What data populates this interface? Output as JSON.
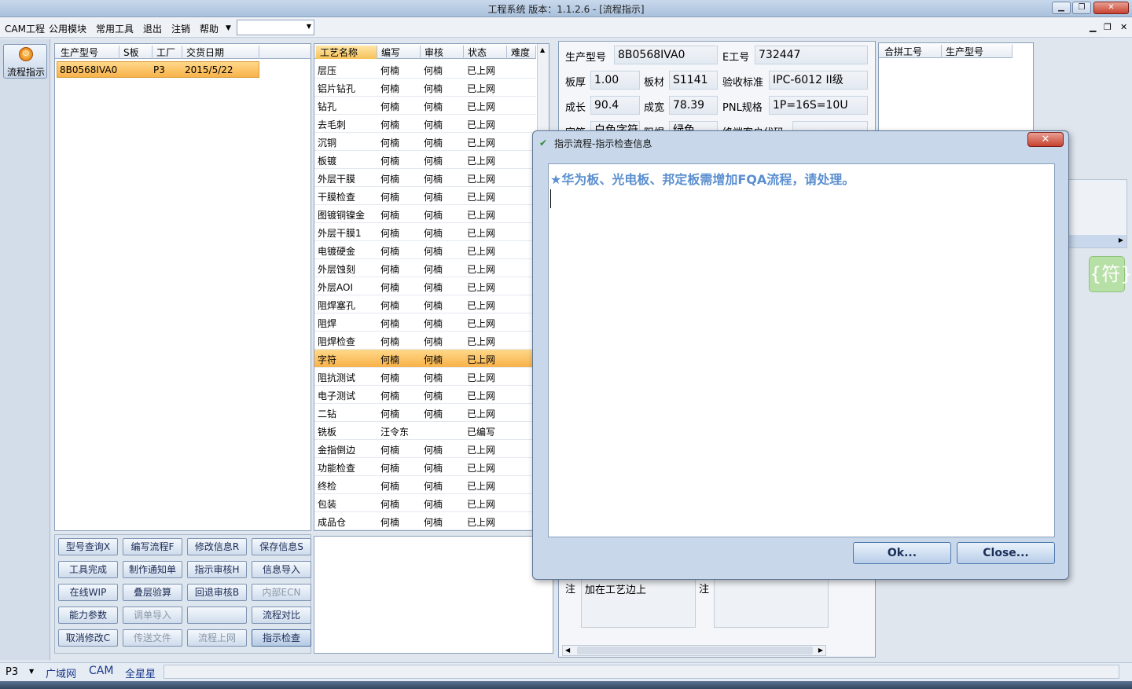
{
  "window": {
    "title": "工程系统  版本：1.1.2.6 - [流程指示]"
  },
  "menu": {
    "items": [
      "CAM工程",
      "公用模块",
      "常用工具",
      "退出",
      "注销",
      "帮助"
    ],
    "combo_value": ""
  },
  "sidebar": {
    "button_label": "流程指示"
  },
  "orders": {
    "columns": [
      "生产型号",
      "S板",
      "工厂",
      "交货日期"
    ],
    "rows": [
      {
        "model": "8B0568IVA0",
        "s": "",
        "factory": "P3",
        "date": "2015/5/22"
      }
    ]
  },
  "process": {
    "columns": [
      "工艺名称",
      "编写",
      "审核",
      "状态",
      "难度"
    ],
    "rows": [
      {
        "name": "层压",
        "writer": "何楠",
        "reviewer": "何楠",
        "status": "已上网"
      },
      {
        "name": "铝片钻孔",
        "writer": "何楠",
        "reviewer": "何楠",
        "status": "已上网"
      },
      {
        "name": "钻孔",
        "writer": "何楠",
        "reviewer": "何楠",
        "status": "已上网"
      },
      {
        "name": "去毛刺",
        "writer": "何楠",
        "reviewer": "何楠",
        "status": "已上网"
      },
      {
        "name": "沉铜",
        "writer": "何楠",
        "reviewer": "何楠",
        "status": "已上网"
      },
      {
        "name": "板镀",
        "writer": "何楠",
        "reviewer": "何楠",
        "status": "已上网"
      },
      {
        "name": "外层干膜",
        "writer": "何楠",
        "reviewer": "何楠",
        "status": "已上网"
      },
      {
        "name": "干膜检查",
        "writer": "何楠",
        "reviewer": "何楠",
        "status": "已上网"
      },
      {
        "name": "图镀铜镍金",
        "writer": "何楠",
        "reviewer": "何楠",
        "status": "已上网"
      },
      {
        "name": "外层干膜1",
        "writer": "何楠",
        "reviewer": "何楠",
        "status": "已上网"
      },
      {
        "name": "电镀硬金",
        "writer": "何楠",
        "reviewer": "何楠",
        "status": "已上网"
      },
      {
        "name": "外层蚀刻",
        "writer": "何楠",
        "reviewer": "何楠",
        "status": "已上网"
      },
      {
        "name": "外层AOI",
        "writer": "何楠",
        "reviewer": "何楠",
        "status": "已上网"
      },
      {
        "name": "阻焊塞孔",
        "writer": "何楠",
        "reviewer": "何楠",
        "status": "已上网"
      },
      {
        "name": "阻焊",
        "writer": "何楠",
        "reviewer": "何楠",
        "status": "已上网"
      },
      {
        "name": "阻焊检查",
        "writer": "何楠",
        "reviewer": "何楠",
        "status": "已上网"
      },
      {
        "name": "字符",
        "writer": "何楠",
        "reviewer": "何楠",
        "status": "已上网"
      },
      {
        "name": "阻抗测试",
        "writer": "何楠",
        "reviewer": "何楠",
        "status": "已上网"
      },
      {
        "name": "电子测试",
        "writer": "何楠",
        "reviewer": "何楠",
        "status": "已上网"
      },
      {
        "name": "二钻",
        "writer": "何楠",
        "reviewer": "何楠",
        "status": "已上网"
      },
      {
        "name": "铣板",
        "writer": "汪令东",
        "reviewer": "",
        "status": "已编写"
      },
      {
        "name": "金指倒边",
        "writer": "何楠",
        "reviewer": "何楠",
        "status": "已上网"
      },
      {
        "name": "功能检查",
        "writer": "何楠",
        "reviewer": "何楠",
        "status": "已上网"
      },
      {
        "name": "终检",
        "writer": "何楠",
        "reviewer": "何楠",
        "status": "已上网"
      },
      {
        "name": "包装",
        "writer": "何楠",
        "reviewer": "何楠",
        "status": "已上网"
      },
      {
        "name": "成品仓",
        "writer": "何楠",
        "reviewer": "何楠",
        "status": "已上网"
      }
    ]
  },
  "buttons": [
    "型号查询X",
    "编写流程F",
    "修改信息R",
    "保存信息S",
    "工具完成",
    "制作通知单",
    "指示审核H",
    "信息导入",
    "在线WIP",
    "叠层验算",
    "回退审核B",
    "内部ECN",
    "能力参数",
    "调单导入",
    "",
    "流程对比",
    "取消修改C",
    "传送文件",
    "流程上网",
    "指示检查"
  ],
  "info": {
    "model_label": "生产型号",
    "model": "8B0568IVA0",
    "eng_label": "E工号",
    "eng": "732447",
    "thick_label": "板厚",
    "thick": "1.00",
    "mat_label": "板材",
    "mat": "S1141",
    "std_label": "验收标准",
    "std": "IPC-6012 II级",
    "len_label": "成长",
    "len": "90.4",
    "wid_label": "成宽",
    "wid": "78.39",
    "pnl_label": "PNL规格",
    "pnl": "1P=16S=10U",
    "char_label": "字符",
    "char": "白色字符",
    "mask_label": "阻焊",
    "mask": "绿色",
    "cust_label": "终端客户代码",
    "cust": ""
  },
  "merge": {
    "columns": [
      "合拼工号",
      "生产型号"
    ]
  },
  "symbol_button": "{符}",
  "notes": {
    "label1": "注",
    "text1": "加在工艺边上",
    "label2": "注"
  },
  "dialog": {
    "title": "指示流程-指示检查信息",
    "message": "★华为板、光电板、邦定板需增加FQA流程，请处理。",
    "ok": "Ok...",
    "close": "Close...",
    "close_x": "✕"
  },
  "status": {
    "combo": "P3",
    "tabs": [
      "广域网",
      "CAM",
      "全星星"
    ]
  }
}
